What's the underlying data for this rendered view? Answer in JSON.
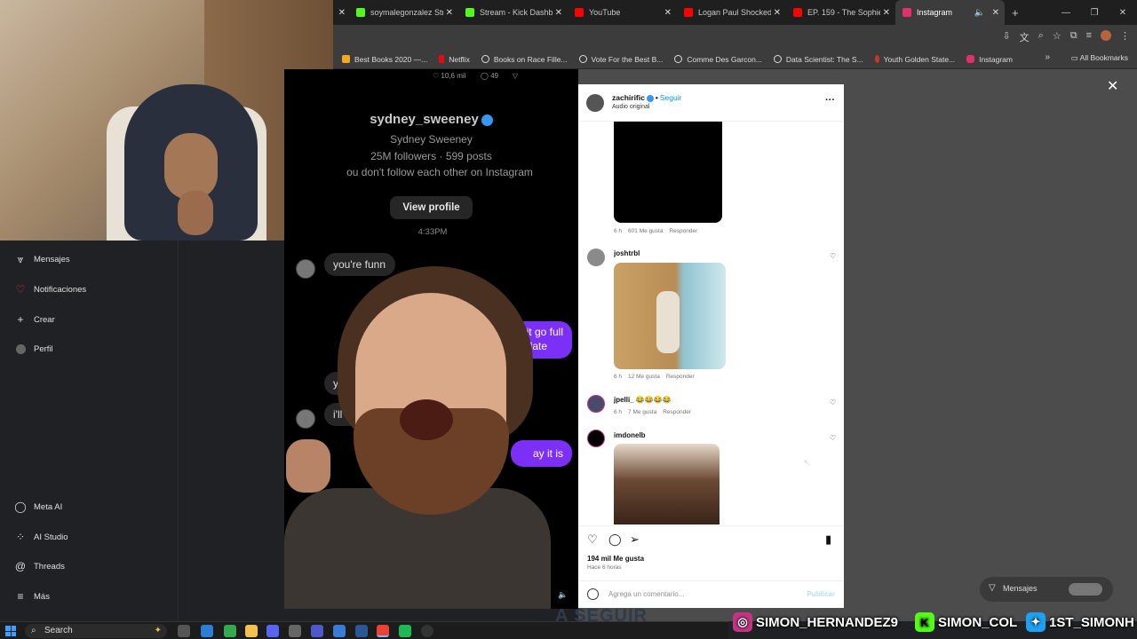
{
  "browser": {
    "tabs": [
      {
        "label": "soymalegonzalez Stre",
        "color": "#53fc18",
        "active": false
      },
      {
        "label": "Stream - Kick Dashb",
        "color": "#53fc18",
        "active": false
      },
      {
        "label": "YouTube",
        "color": "#ff0000",
        "active": false
      },
      {
        "label": "Logan Paul Shocked",
        "color": "#ff0000",
        "active": false
      },
      {
        "label": "EP. 159 - The Sophie",
        "color": "#ff0000",
        "active": false
      },
      {
        "label": "Instagram",
        "color": "#e1306c",
        "active": true
      }
    ],
    "bookmarks": [
      {
        "label": "Best Books 2020 —...",
        "color": "#f5a623"
      },
      {
        "label": "Netflix",
        "color": "#e50914"
      },
      {
        "label": "Books on Race Fille...",
        "color": "#ddd"
      },
      {
        "label": "Vote For the Best B...",
        "color": "#ddd"
      },
      {
        "label": "Comme Des Garcon...",
        "color": "#ddd"
      },
      {
        "label": "Data Scientist: The S...",
        "color": "#ddd"
      },
      {
        "label": "Youth Golden State...",
        "color": "#c0392b"
      },
      {
        "label": "Instagram",
        "color": "#e1306c"
      }
    ],
    "all_bookmarks": "All Bookmarks"
  },
  "leftnav": {
    "items": [
      {
        "label": "Mensajes",
        "icon": "messenger-icon"
      },
      {
        "label": "Notificaciones",
        "icon": "heart-icon"
      },
      {
        "label": "Crear",
        "icon": "plus-icon"
      },
      {
        "label": "Perfil",
        "icon": "profile-icon"
      },
      {
        "label": "Meta AI",
        "icon": "meta-ai-icon"
      },
      {
        "label": "AI Studio",
        "icon": "ai-studio-icon"
      },
      {
        "label": "Threads",
        "icon": "threads-icon"
      },
      {
        "label": "Más",
        "icon": "menu-icon"
      }
    ]
  },
  "dm": {
    "likes_top": "10,6 mil",
    "comments_top": "49",
    "username": "sydney_sweeney",
    "full_name": "Sydney Sweeney",
    "stats": "25M followers · 599 posts",
    "note": "ou don't follow each other on Instagram",
    "view_profile": "View profile",
    "time": "4:33PM",
    "messages": {
      "m1": "you're funn",
      "m2a": "it go full",
      "m2b": "date",
      "m3": "you",
      "m4": "i'll",
      "m5": "ay it is"
    }
  },
  "modal": {
    "username": "zachirific",
    "follow": "Seguir",
    "audio": "Audio original",
    "comments": [
      {
        "time": "6 h",
        "likes": "601 Me gusta",
        "reply": "Responder"
      },
      {
        "user": "joshtrbl",
        "time": "6 h",
        "likes": "12 Me gusta",
        "reply": "Responder"
      },
      {
        "user": "jpelli_",
        "text": "😂😂😂😂",
        "time": "6 h",
        "likes": "7 Me gusta",
        "reply": "Responder"
      },
      {
        "user": "imdonelb"
      }
    ],
    "likes": "194 mil Me gusta",
    "ago": "Hace 6 horas",
    "comment_placeholder": "Agrega un comentario...",
    "publish": "Publicar"
  },
  "right_messages": "Mensajes",
  "overlay": {
    "a_seguir": "A SEGUIR",
    "instagram": "SIMON_HERNANDEZ9",
    "kick": "SIMON_COL",
    "twitter": "1ST_SIMONH"
  },
  "taskbar": {
    "search": "Search"
  }
}
